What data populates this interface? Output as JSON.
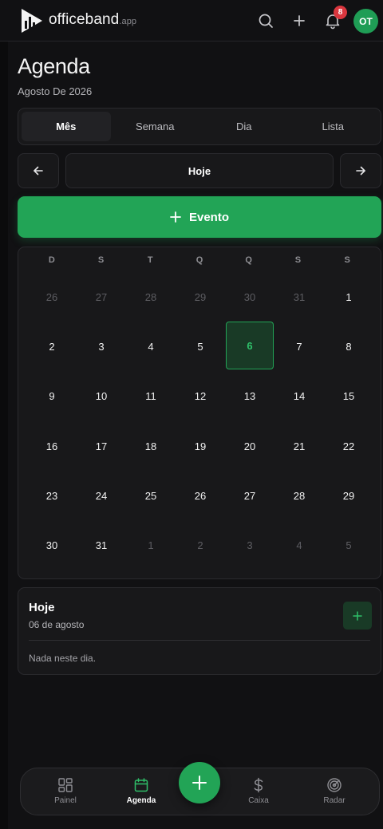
{
  "header": {
    "logo_text": "officeband",
    "logo_suffix": ".app",
    "notification_count": "8",
    "avatar_initials": "OT"
  },
  "page": {
    "title": "Agenda",
    "subtitle": "Agosto De 2026"
  },
  "tabs": [
    {
      "label": "Mês",
      "active": true
    },
    {
      "label": "Semana",
      "active": false
    },
    {
      "label": "Dia",
      "active": false
    },
    {
      "label": "Lista",
      "active": false
    }
  ],
  "navigation": {
    "today_label": "Hoje"
  },
  "event_button": {
    "label": "Evento"
  },
  "calendar": {
    "weekdays": [
      "D",
      "S",
      "T",
      "Q",
      "Q",
      "S",
      "S"
    ],
    "days": [
      {
        "d": "26",
        "m": true
      },
      {
        "d": "27",
        "m": true
      },
      {
        "d": "28",
        "m": true
      },
      {
        "d": "29",
        "m": true
      },
      {
        "d": "30",
        "m": true
      },
      {
        "d": "31",
        "m": true
      },
      {
        "d": "1"
      },
      {
        "d": "2"
      },
      {
        "d": "3"
      },
      {
        "d": "4"
      },
      {
        "d": "5"
      },
      {
        "d": "6",
        "today": true
      },
      {
        "d": "7"
      },
      {
        "d": "8"
      },
      {
        "d": "9"
      },
      {
        "d": "10"
      },
      {
        "d": "11"
      },
      {
        "d": "12"
      },
      {
        "d": "13"
      },
      {
        "d": "14"
      },
      {
        "d": "15"
      },
      {
        "d": "16"
      },
      {
        "d": "17"
      },
      {
        "d": "18"
      },
      {
        "d": "19"
      },
      {
        "d": "20"
      },
      {
        "d": "21"
      },
      {
        "d": "22"
      },
      {
        "d": "23"
      },
      {
        "d": "24"
      },
      {
        "d": "25"
      },
      {
        "d": "26"
      },
      {
        "d": "27"
      },
      {
        "d": "28"
      },
      {
        "d": "29"
      },
      {
        "d": "30"
      },
      {
        "d": "31"
      },
      {
        "d": "1",
        "m": true
      },
      {
        "d": "2",
        "m": true
      },
      {
        "d": "3",
        "m": true
      },
      {
        "d": "4",
        "m": true
      },
      {
        "d": "5",
        "m": true
      }
    ]
  },
  "today_panel": {
    "title": "Hoje",
    "date": "06 de agosto",
    "empty_text": "Nada neste dia."
  },
  "bottom_nav": [
    {
      "label": "Painel",
      "icon": "dashboard-icon",
      "active": false
    },
    {
      "label": "Agenda",
      "icon": "calendar-icon",
      "active": true
    },
    {
      "label": "Caixa",
      "icon": "dollar-icon",
      "active": false
    },
    {
      "label": "Radar",
      "icon": "radar-icon",
      "active": false
    }
  ],
  "colors": {
    "accent": "#22a456",
    "background": "#111113",
    "surface": "#18181a",
    "badge": "#d9363e"
  }
}
